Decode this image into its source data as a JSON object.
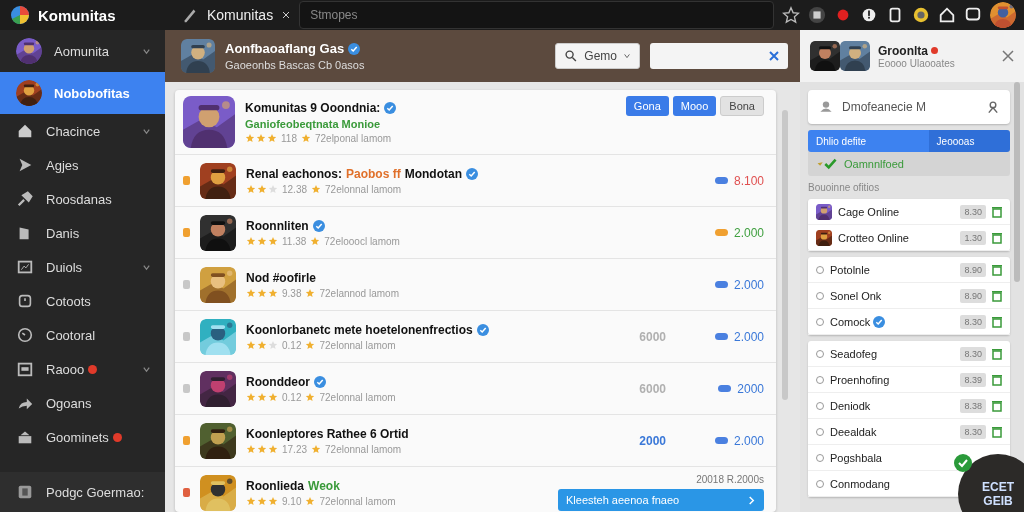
{
  "topbar": {
    "app_title": "Komunitas",
    "tab_title": "Komunitas",
    "search": {
      "placeholder": "Stmopes"
    }
  },
  "sidebar": {
    "items": [
      {
        "label": "Aomunita",
        "chevron": true,
        "badge": false,
        "selected": false
      },
      {
        "label": "Nobobofitas",
        "chevron": false,
        "badge": false,
        "selected": true
      },
      {
        "label": "Chacince",
        "chevron": true,
        "badge": false,
        "selected": false
      },
      {
        "label": "Agjes",
        "chevron": false,
        "badge": false,
        "selected": false
      },
      {
        "label": "Roosdanas",
        "chevron": false,
        "badge": false,
        "selected": false
      },
      {
        "label": "Danis",
        "chevron": false,
        "badge": false,
        "selected": false
      },
      {
        "label": "Duiols",
        "chevron": true,
        "badge": false,
        "selected": false
      },
      {
        "label": "Cotoots",
        "chevron": false,
        "badge": false,
        "selected": false
      },
      {
        "label": "Cootoral",
        "chevron": false,
        "badge": false,
        "selected": false
      },
      {
        "label": "Raooo",
        "chevron": true,
        "badge": true,
        "selected": false
      },
      {
        "label": "Ogoans",
        "chevron": false,
        "badge": false,
        "selected": false
      },
      {
        "label": "Goominets",
        "chevron": false,
        "badge": true,
        "selected": false
      },
      {
        "label": "Podgc Goermao:",
        "chevron": false,
        "badge": false,
        "selected": false
      }
    ]
  },
  "header": {
    "title": "Aonfbaoaflang Gas",
    "verified": true,
    "subtitle": "Gaoeonbs Bascas Cb 0asos",
    "filter_label": "Gemo"
  },
  "chat": {
    "title": "Groonlta",
    "badge": true,
    "subtitle": "Eoooo Ulaooates"
  },
  "list": {
    "rows": [
      {
        "kind": "featured",
        "title_parts": [
          {
            "text": "Komunitas 9 Ooondnia:"
          }
        ],
        "verified": true,
        "subtitle": "Ganiofeobeqtnata Monioe",
        "stars": 3,
        "rating": "118",
        "meta": "72elponal lamom",
        "buttons": [
          {
            "label": "Gona",
            "kind": "primary"
          },
          {
            "label": "Mooo",
            "kind": "primary"
          },
          {
            "label": "Bona",
            "kind": "secondary"
          }
        ]
      },
      {
        "kind": "item",
        "color": "#f0a030",
        "title_parts": [
          {
            "text": "Renal eachonos:"
          },
          {
            "text": "Paobos ff",
            "color": "#e0702a"
          },
          {
            "text": "Mondotan"
          }
        ],
        "verified": true,
        "stars": 2,
        "rating": "12.38",
        "meta": "72elonnal lamom",
        "pill": {
          "color": "#4a80e0"
        },
        "value": {
          "text": "8.100",
          "color": "#e05050"
        }
      },
      {
        "kind": "item",
        "color": "#f0a030",
        "title_parts": [
          {
            "text": "Roonnliten"
          }
        ],
        "verified": true,
        "stars": 3,
        "rating": "11.38",
        "meta": "72elooocl lamom",
        "pill": {
          "color": "#f0a030"
        },
        "value": {
          "text": "2.000",
          "color": "#40a040"
        }
      },
      {
        "kind": "item",
        "color": "#c8c8c8",
        "title_parts": [
          {
            "text": "Nod #oofirle"
          }
        ],
        "verified": false,
        "stars": 3,
        "rating": "9.38",
        "meta": "72elannod lamom",
        "pill": {
          "color": "#4a80e0"
        },
        "value": {
          "text": "2.000",
          "color": "#3a78d8"
        }
      },
      {
        "kind": "item",
        "color": "#c8c8c8",
        "title_parts": [
          {
            "text": "Koonlorbanetc mete hoetelonenfrectios"
          }
        ],
        "verified": true,
        "stars": 2,
        "rating": "0.12",
        "meta": "72elonnal lamom",
        "mid": {
          "text": "6000",
          "color": "#b0b0b0"
        },
        "pill": {
          "color": "#4a80e0"
        },
        "value": {
          "text": "2.000",
          "color": "#3a78d8"
        }
      },
      {
        "kind": "item",
        "color": "#c8c8c8",
        "title_parts": [
          {
            "text": "Roonddeor"
          }
        ],
        "verified": true,
        "stars": 3,
        "rating": "0.12",
        "meta": "72elonnal lamom",
        "mid": {
          "text": "6000",
          "color": "#b0b0b0"
        },
        "pill": {
          "color": "#4a80e0"
        },
        "value": {
          "text": "2000",
          "color": "#3a78d8"
        }
      },
      {
        "kind": "item",
        "color": "#f0a030",
        "title_parts": [
          {
            "text": "Koonleptores Rathee 6 Ortid"
          }
        ],
        "verified": false,
        "stars": 3,
        "rating": "17.23",
        "meta": "72elonnal lamom",
        "mid": {
          "text": "2000",
          "color": "#3a78d8"
        },
        "pill": {
          "color": "#4a80e0"
        },
        "value": {
          "text": "2.000",
          "color": "#3a78d8"
        }
      },
      {
        "kind": "action",
        "color": "#e06040",
        "title_parts": [
          {
            "text": "Roonlieda"
          },
          {
            "text": "Weok",
            "color": "#3a9a3a"
          }
        ],
        "verified": false,
        "stars": 3,
        "rating": "9.10",
        "meta": "72elonnal lamom",
        "note": "20018 R.2000s",
        "action": "Kleesteh aeenoa fnaeo"
      }
    ]
  },
  "panel": {
    "search": {
      "value": "Dmofeanecie M"
    },
    "tabs": [
      {
        "label": "Dhlio defite",
        "selected": true
      },
      {
        "label": "Jeoooas",
        "selected": false
      }
    ],
    "status": {
      "label": "Oamnnlfoed"
    },
    "section_label": "Bouoinne ofitios",
    "groups": [
      {
        "items": [
          {
            "kind": "game",
            "label": "Cage Online",
            "verified": false,
            "value": "8.30"
          },
          {
            "kind": "game",
            "label": "Crotteo Online",
            "verified": false,
            "value": "1.30"
          }
        ]
      },
      {
        "items": [
          {
            "kind": "option",
            "label": "Potolnle",
            "verified": false,
            "value": "8.90"
          },
          {
            "kind": "option",
            "label": "Sonel Onk",
            "verified": false,
            "value": "8.90"
          },
          {
            "kind": "option",
            "label": "Comock",
            "verified": true,
            "value": "8.30"
          }
        ]
      },
      {
        "items": [
          {
            "kind": "option",
            "label": "Seadofeg",
            "verified": false,
            "value": "8.30"
          },
          {
            "kind": "option",
            "label": "Proenhofing",
            "verified": false,
            "value": "8.39"
          },
          {
            "kind": "option",
            "label": "Deniodk",
            "verified": false,
            "value": "8.38"
          },
          {
            "kind": "option",
            "label": "Deealdak",
            "verified": false,
            "value": "8.30"
          },
          {
            "kind": "option",
            "label": "Pogshbala",
            "verified": false
          },
          {
            "kind": "option",
            "label": "Conmodang",
            "verified": false
          }
        ]
      }
    ]
  },
  "fab": {
    "label": "ECET GEIB"
  }
}
